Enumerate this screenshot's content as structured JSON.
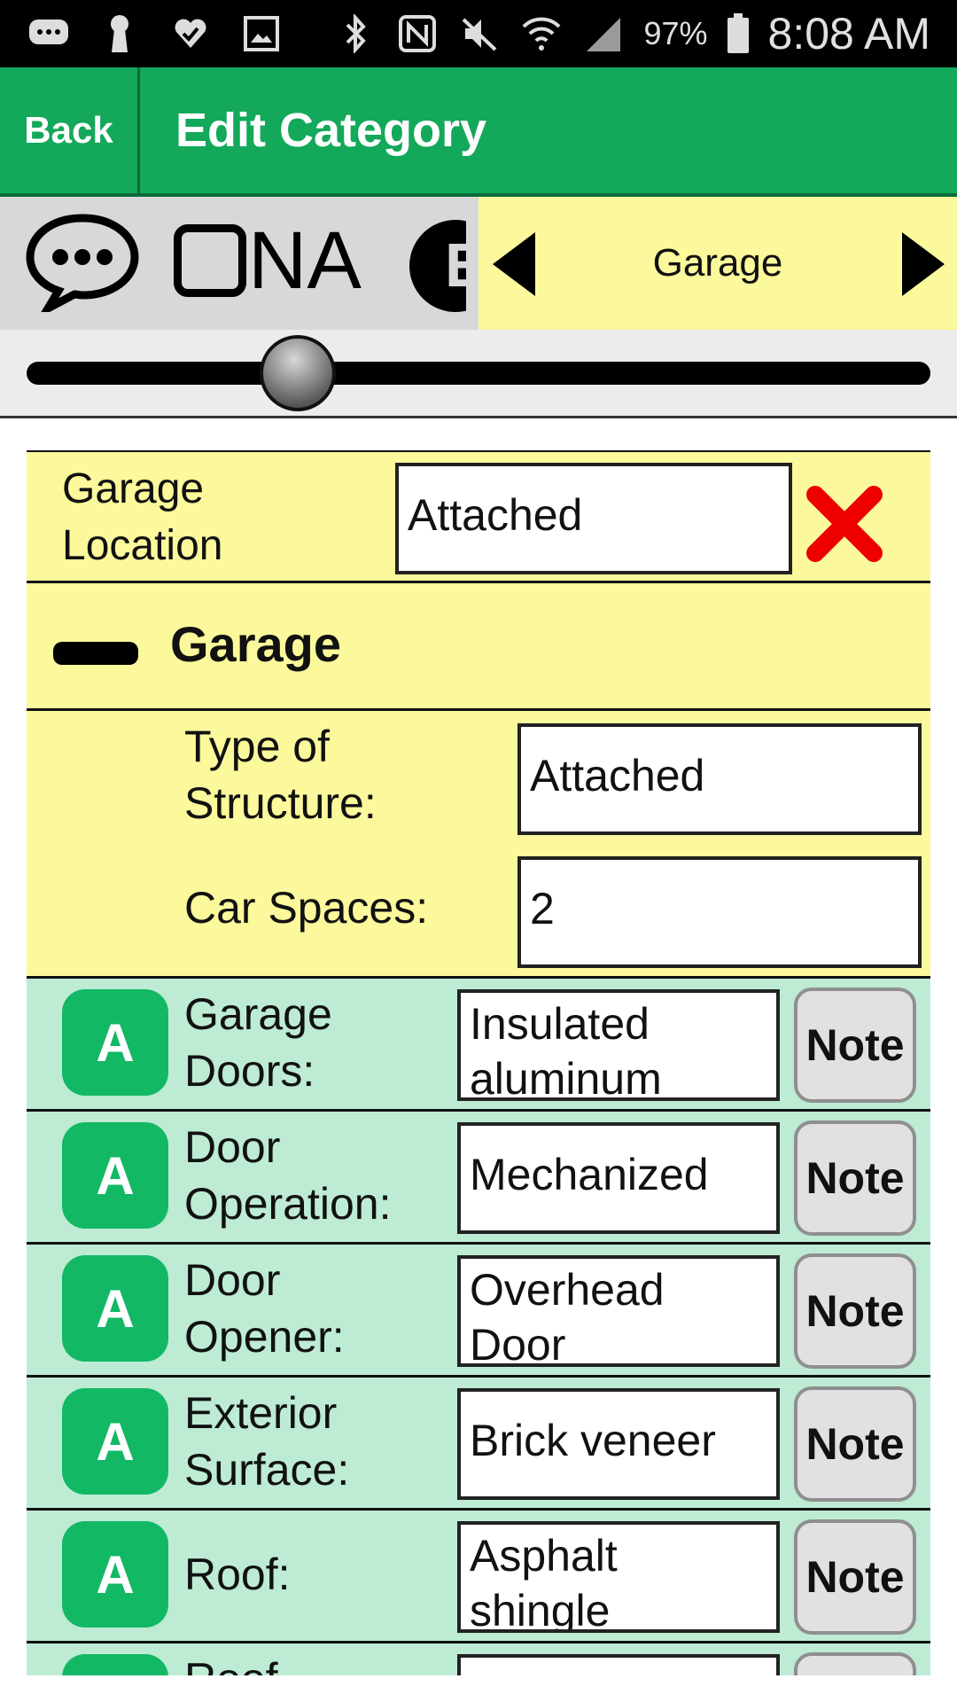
{
  "status_bar": {
    "icons": [
      "message-icon",
      "keyhole-icon",
      "check-heart-icon",
      "image-icon",
      "bluetooth-icon",
      "nfc-icon",
      "mute-icon",
      "wifi-icon",
      "signal-icon",
      "battery-icon"
    ],
    "battery": "97%",
    "time": "8:08 AM"
  },
  "app_bar": {
    "back_label": "Back",
    "title": "Edit Category",
    "color": "#13a85a"
  },
  "toolbar": {
    "tools": [
      "comment-icon",
      "checkbox-icon",
      "e-icon"
    ],
    "na_label": "NA",
    "nav_label": "Garage"
  },
  "slider": {
    "position": 0.3
  },
  "garage_location": {
    "label_line1": "Garage",
    "label_line2": "Location",
    "value": "Attached"
  },
  "section": {
    "title": "Garage",
    "fields": [
      {
        "label_line1": "Type of",
        "label_line2": "Structure:",
        "value": "Attached"
      },
      {
        "label_line1": "Car Spaces:",
        "label_line2": "",
        "value": "2"
      }
    ]
  },
  "items": [
    {
      "badge": "A",
      "label_line1": "Garage",
      "label_line2": "Doors:",
      "value_line1": "Insulated",
      "value_line2": "aluminum",
      "note": "Note"
    },
    {
      "badge": "A",
      "label_line1": "Door",
      "label_line2": "Operation:",
      "value_line1": "Mechanized",
      "value_line2": "",
      "note": "Note"
    },
    {
      "badge": "A",
      "label_line1": "Door",
      "label_line2": "Opener:",
      "value_line1": "Overhead",
      "value_line2": "Door",
      "note": "Note"
    },
    {
      "badge": "A",
      "label_line1": "Exterior",
      "label_line2": "Surface:",
      "value_line1": "Brick veneer",
      "value_line2": "",
      "note": "Note"
    },
    {
      "badge": "A",
      "label_line1": "Roof:",
      "label_line2": "",
      "value_line1": "Asphalt",
      "value_line2": "shingle",
      "note": "Note"
    },
    {
      "badge": "A",
      "label_line1": "Roof",
      "label_line2": "",
      "value_line1": "",
      "value_line2": "",
      "note": ""
    }
  ]
}
